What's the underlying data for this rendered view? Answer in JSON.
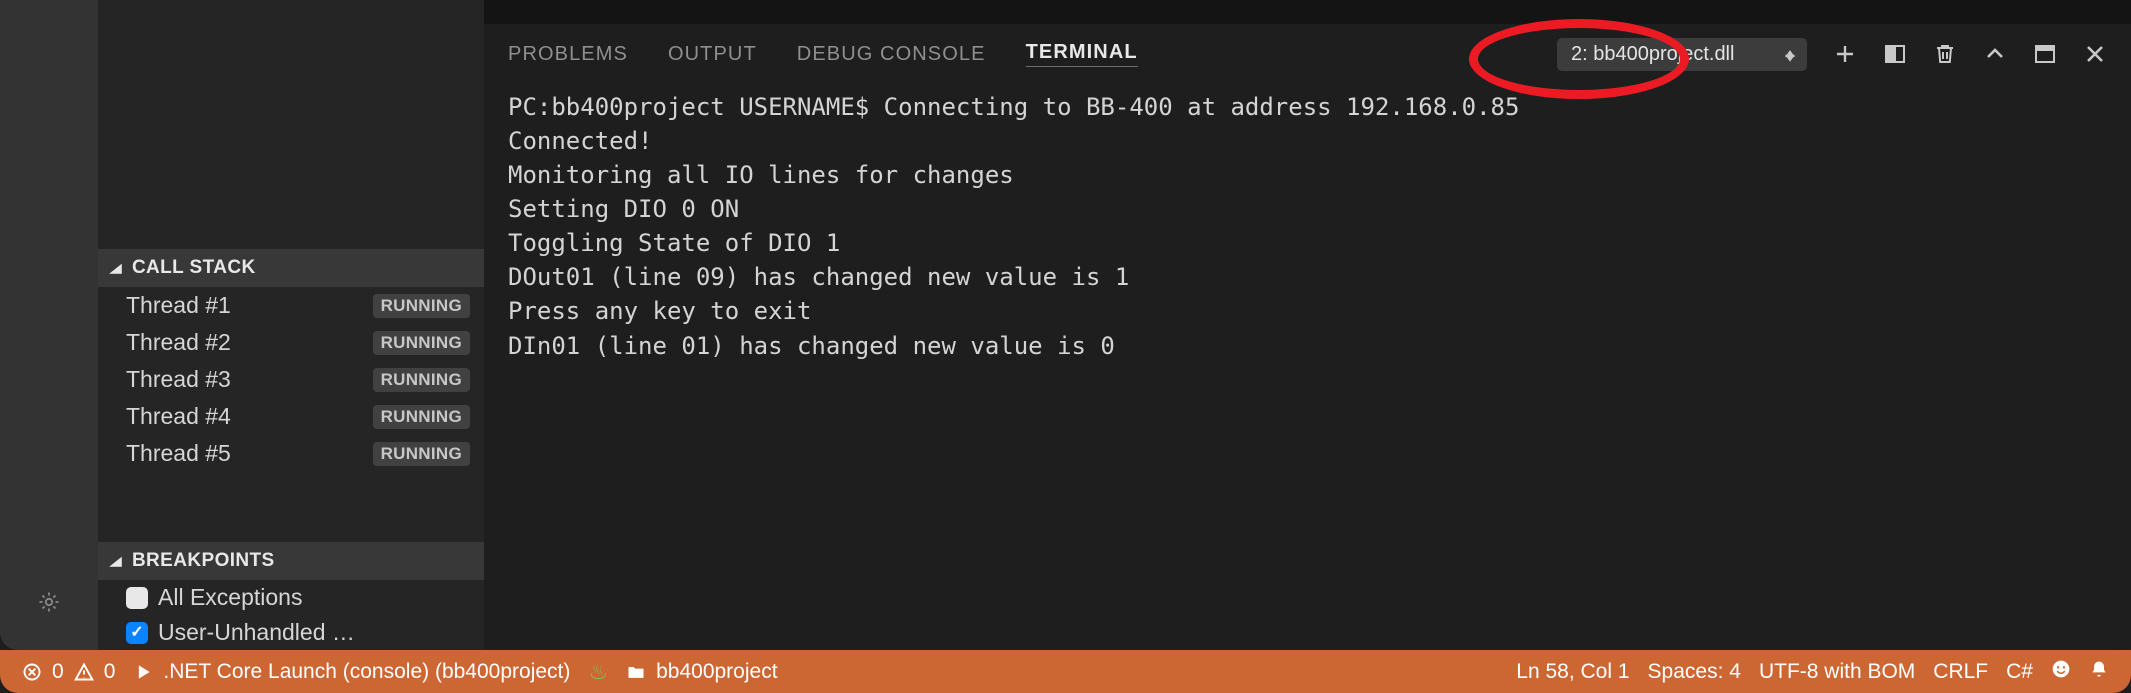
{
  "sidebar": {
    "callstack": {
      "title": "CALL STACK",
      "items": [
        {
          "label": "Thread #1",
          "state": "RUNNING"
        },
        {
          "label": "Thread #2",
          "state": "RUNNING"
        },
        {
          "label": "Thread #3",
          "state": "RUNNING"
        },
        {
          "label": "Thread #4",
          "state": "RUNNING"
        },
        {
          "label": "Thread #5",
          "state": "RUNNING"
        }
      ]
    },
    "breakpoints": {
      "title": "BREAKPOINTS",
      "items": [
        {
          "label": "All Exceptions",
          "checked": false
        },
        {
          "label": "User-Unhandled …",
          "checked": true
        }
      ]
    }
  },
  "panel": {
    "tabs": {
      "problems": "PROBLEMS",
      "output": "OUTPUT",
      "debug_console": "DEBUG CONSOLE",
      "terminal": "TERMINAL"
    },
    "active_tab": "terminal",
    "terminal_select": "2: bb400project.dll",
    "terminal_lines": [
      "PC:bb400project USERNAME$ Connecting to BB-400 at address 192.168.0.85",
      "Connected!",
      "Monitoring all IO lines for changes",
      "Setting DIO 0 ON",
      "Toggling State of DIO 1",
      "DOut01 (line 09) has changed new value is 1",
      "Press any key to exit",
      "DIn01 (line 01) has changed new value is 0"
    ]
  },
  "status": {
    "errors": "0",
    "warnings": "0",
    "launch": ".NET Core Launch (console) (bb400project)",
    "project": "bb400project",
    "cursor": "Ln 58, Col 1",
    "indent": "Spaces: 4",
    "encoding": "UTF-8 with BOM",
    "eol": "CRLF",
    "lang": "C#"
  }
}
